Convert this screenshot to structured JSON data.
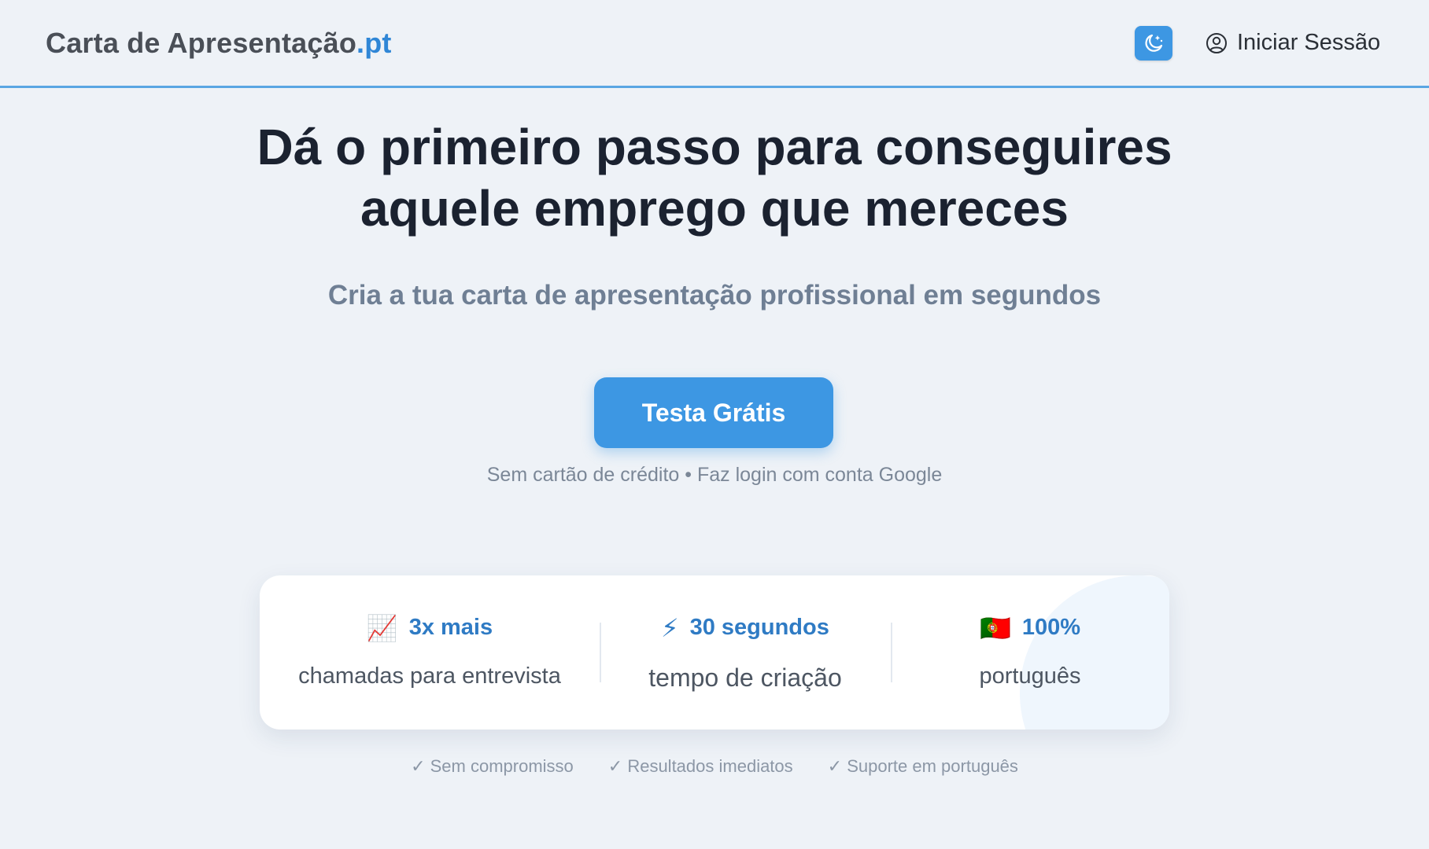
{
  "header": {
    "brand_main": "Carta de Apresentação",
    "brand_tld": ".pt",
    "theme_icon": "moon-stars-icon",
    "signin_icon": "user-circle-icon",
    "signin_label": "Iniciar Sessão"
  },
  "hero": {
    "title_line1": "Dá o primeiro passo para conseguires",
    "title_line2": "aquele emprego que mereces",
    "subtitle": "Cria a tua carta de apresentação profissional em segundos",
    "cta_label": "Testa Grátis",
    "cta_note": "Sem cartão de crédito • Faz login com conta Google"
  },
  "stats": [
    {
      "icon": "chart-increasing-icon",
      "emoji": "📈",
      "value": "3x mais",
      "caption": "chamadas para entrevista"
    },
    {
      "icon": "lightning-icon",
      "emoji": "⚡",
      "value": "30 segundos",
      "caption": "tempo de criação"
    },
    {
      "icon": "portugal-flag-icon",
      "emoji": "🇵🇹",
      "value": "100%",
      "caption": "português"
    }
  ],
  "checks": [
    "✓ Sem compromisso",
    "✓ Resultados imediatos",
    "✓ Suporte em português"
  ],
  "colors": {
    "accent": "#3d97e3",
    "brand_tld": "#2f86d6",
    "stat_value": "#2f7bc4",
    "background": "#eef2f7"
  }
}
